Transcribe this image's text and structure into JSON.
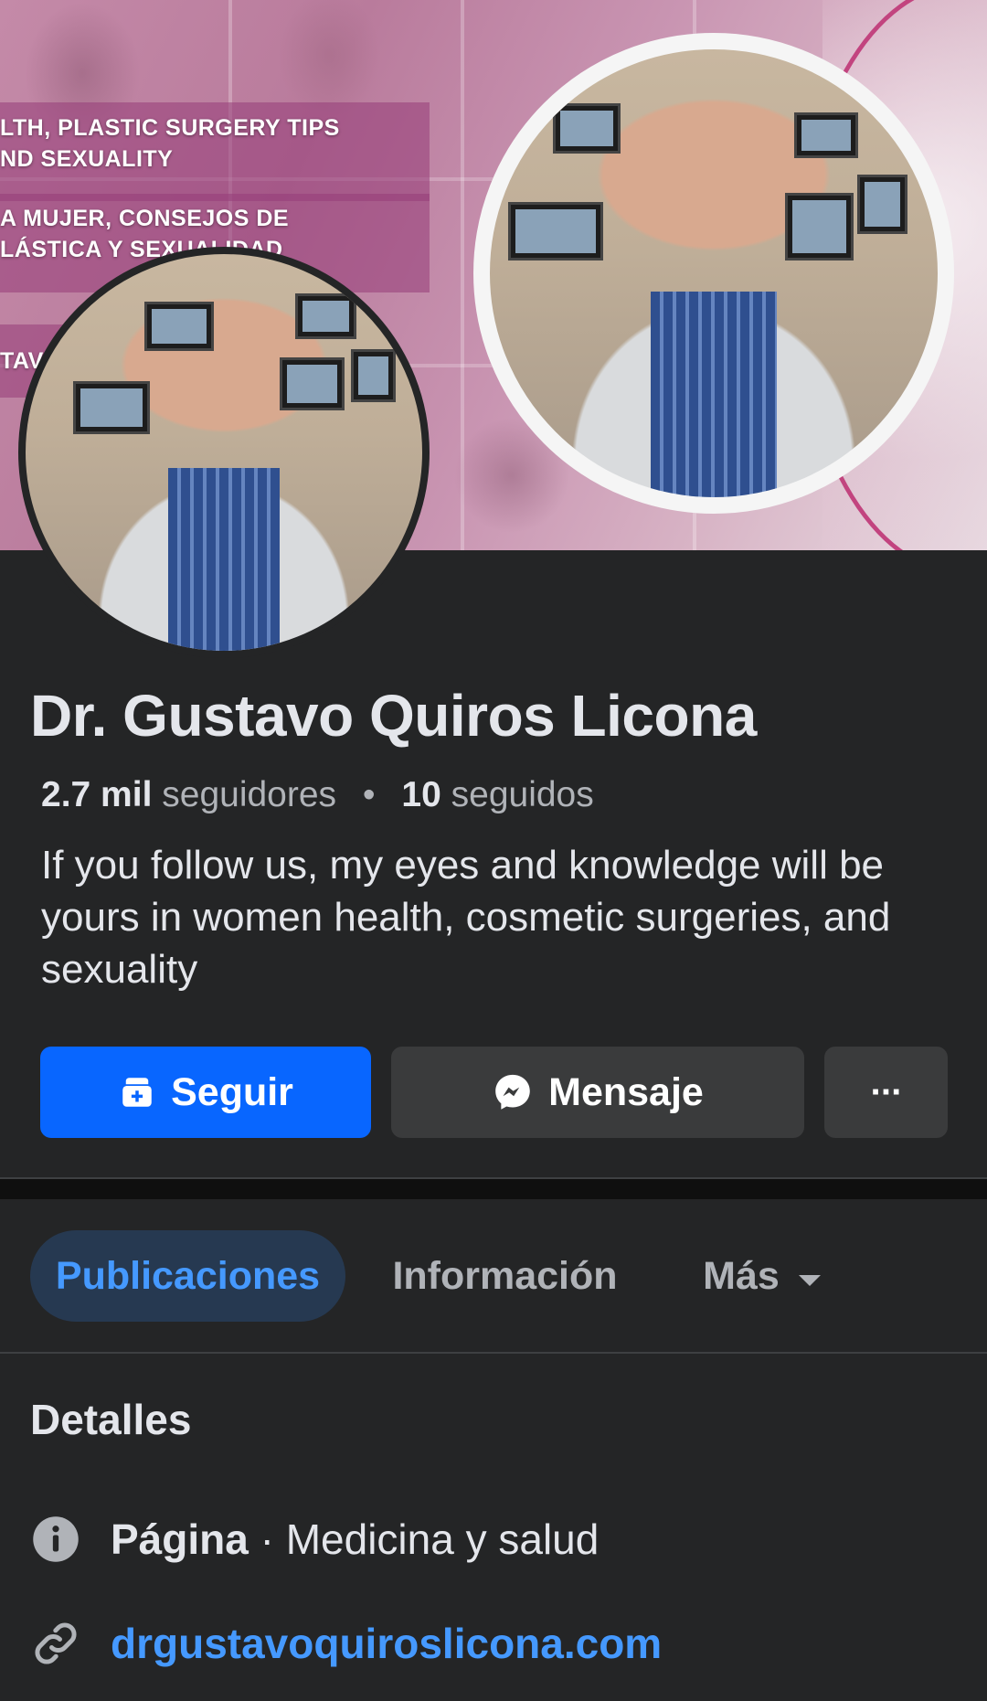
{
  "cover": {
    "lines": [
      "LTH, PLASTIC SURGERY TIPS",
      "ND SEXUALITY",
      "A MUJER, CONSEJOS DE",
      "LÁSTICA Y SEXUALIDAD",
      "TAV"
    ]
  },
  "profile": {
    "name": "Dr. Gustavo Quiros Licona",
    "followers_count": "2.7 mil",
    "followers_label": "seguidores",
    "separator": "•",
    "following_count": "10",
    "following_label": "seguidos",
    "bio": "If you follow us, my eyes and knowledge will be yours in women health, cosmetic surgeries, and sexuality"
  },
  "actions": {
    "follow_label": "Seguir",
    "message_label": "Mensaje",
    "more_label": "···"
  },
  "tabs": [
    {
      "label": "Publicaciones",
      "active": true
    },
    {
      "label": "Información",
      "active": false
    },
    {
      "label": "Más",
      "active": false
    }
  ],
  "details": {
    "title": "Detalles",
    "category_type": "Página",
    "category_separator": " · ",
    "category_value": "Medicina y salud",
    "website": "drgustavoquiroslicona.com"
  },
  "icons": {
    "follow": "follow-page-icon",
    "message": "messenger-icon",
    "more_tab": "caret-down-icon",
    "category": "info-icon",
    "website": "link-icon"
  },
  "colors": {
    "background": "#242526",
    "primary_button": "#0866ff",
    "secondary_button": "#3a3b3c",
    "active_tab_bg": "#263951",
    "link": "#4599ff"
  }
}
